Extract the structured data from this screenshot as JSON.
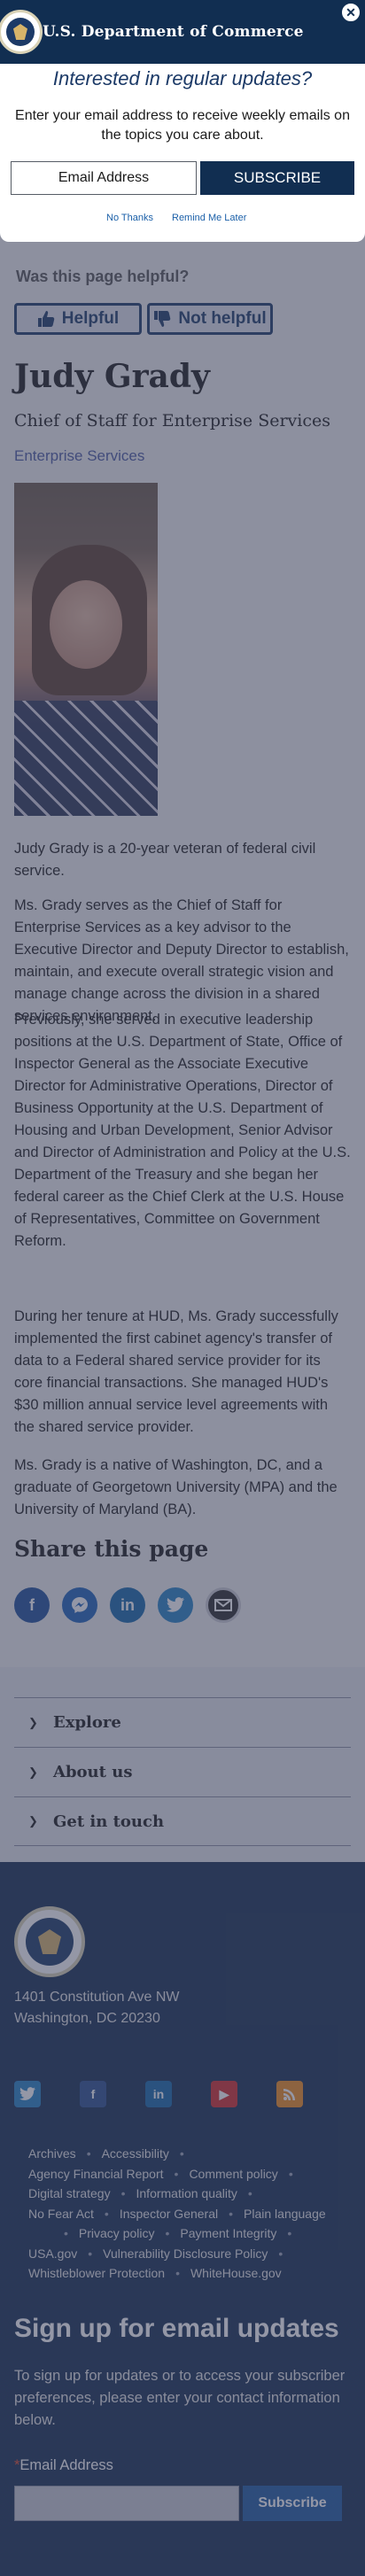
{
  "header": {
    "title": "U.S. Department of Commerce"
  },
  "modal": {
    "heading": "Interested in regular updates?",
    "description": "Enter your email address to receive weekly emails on the topics you care about.",
    "email_placeholder": "Email Address",
    "subscribe_label": "SUBSCRIBE",
    "no_thanks": "No Thanks",
    "remind_later": "Remind Me Later",
    "close_icon": "close-icon"
  },
  "feedback": {
    "question": "Was this page helpful?",
    "helpful_label": "Helpful",
    "not_helpful_label": "Not helpful"
  },
  "profile": {
    "name": "Judy Grady",
    "title": "Chief of Staff for Enterprise Services",
    "department": "Enterprise Services",
    "bio": [
      "Judy Grady is a 20-year veteran of federal civil service.",
      "Ms. Grady serves as the Chief of Staff for Enterprise Services as a key advisor to the Executive Director and Deputy Director to establish, maintain, and execute overall strategic vision and manage change across the division in a shared services environment.",
      "Previously, she served in executive leadership positions at the U.S. Department of State, Office of Inspector General as the Associate Executive Director for Administrative Operations, Director of Business Opportunity at the U.S. Department of Housing and Urban Development, Senior Advisor and Director of Administration and Policy at the U.S. Department of the Treasury and she began her federal career as the Chief Clerk at the U.S. House of Representatives, Committee on Government Reform.",
      "During her tenure at HUD, Ms. Grady successfully implemented the first cabinet agency's transfer of data to a Federal shared service provider for its core financial transactions. She managed HUD's $30 million annual service level agreements with the shared service provider.",
      "Ms. Grady is a native of Washington, DC, and a graduate of Georgetown University (MPA) and the University of Maryland (BA)."
    ]
  },
  "share": {
    "title": "Share this page",
    "icons": [
      "facebook-icon",
      "messenger-icon",
      "linkedin-icon",
      "twitter-icon",
      "email-icon"
    ]
  },
  "accordion": {
    "items": [
      {
        "label": "Explore"
      },
      {
        "label": "About us"
      },
      {
        "label": "Get in touch"
      }
    ]
  },
  "footer": {
    "address_line1": "1401 Constitution Ave NW",
    "address_line2": "Washington, DC 20230",
    "social": [
      "twitter-icon",
      "facebook-icon",
      "linkedin-icon",
      "youtube-icon",
      "rss-icon"
    ],
    "links": {
      "row1": [
        "Archives",
        "Accessibility"
      ],
      "row2": [
        "Agency Financial Report",
        "Comment policy"
      ],
      "row3": [
        "Digital strategy",
        "Information quality"
      ],
      "row4": [
        "No Fear Act",
        "Inspector General",
        "Plain language"
      ],
      "row5": [
        "Privacy policy",
        "Payment Integrity"
      ],
      "row6": [
        "USA.gov",
        "Vulnerability Disclosure Policy"
      ],
      "row7": [
        "Whistleblower Protection",
        "WhiteHouse.gov"
      ]
    },
    "signup_title": "Sign up for email updates",
    "signup_desc": "To sign up for updates or to access your subscriber preferences, please enter your contact information below.",
    "email_label": "Email Address",
    "required_mark": "*",
    "subscribe_label": "Subscribe"
  },
  "colors": {
    "navy": "#112e51",
    "footer_bg": "#162e51",
    "link_blue": "#1a5fa8",
    "accent_blue": "#1e5aa0"
  }
}
